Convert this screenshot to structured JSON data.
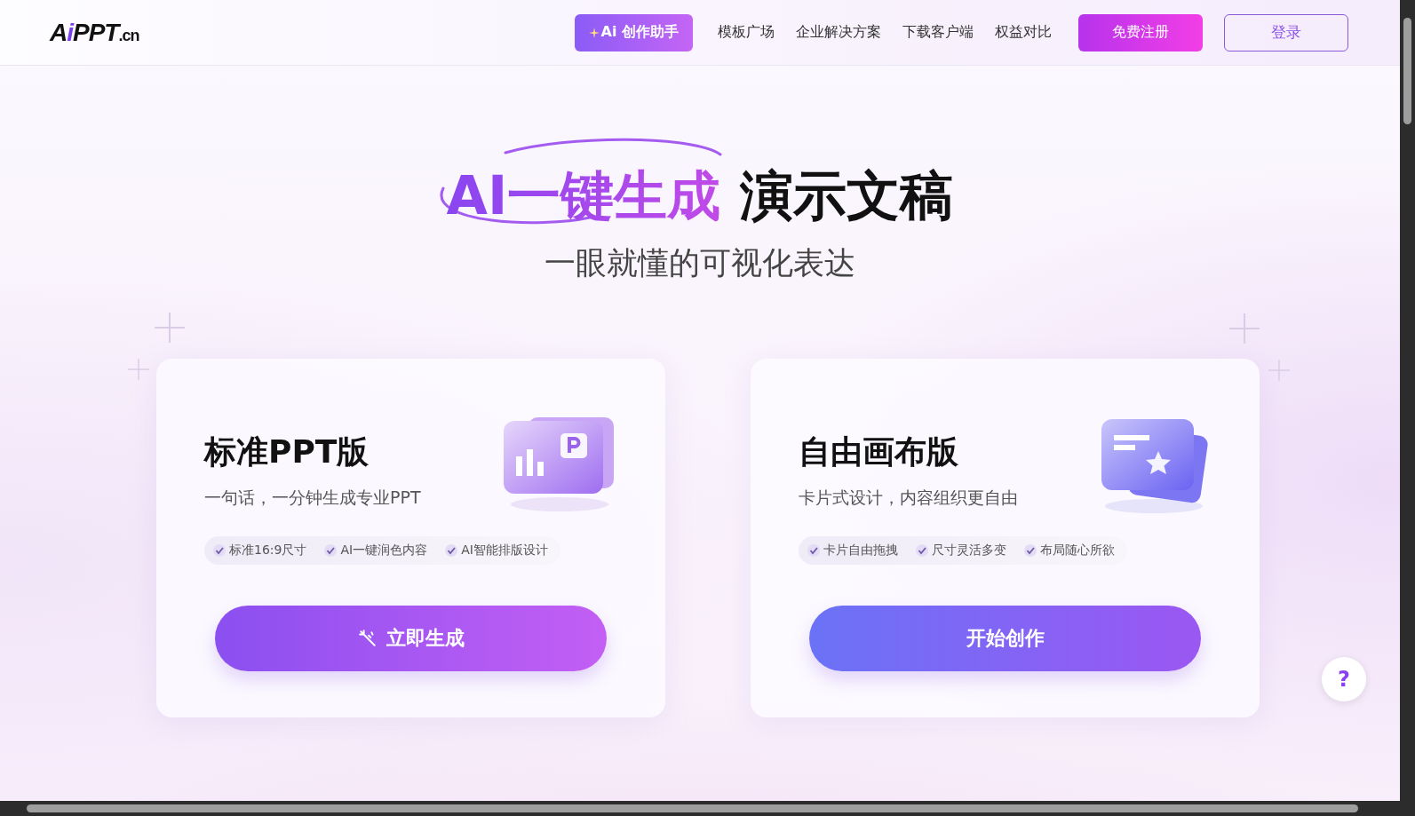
{
  "logo": {
    "initial": "A",
    "accent": "i",
    "name": "PPT",
    "suffix": ".cn"
  },
  "nav": {
    "assistant": "Ai 创作助手",
    "links": [
      "模板广场",
      "企业解决方案",
      "下载客户端",
      "权益对比"
    ],
    "register": "免费注册",
    "login": "登录"
  },
  "hero": {
    "highlight": "AI一键生成",
    "title": "演示文稿",
    "subtitle": "一眼就懂的可视化表达"
  },
  "cards": [
    {
      "kind": "ppt",
      "title": "标准PPT版",
      "subtitle": "一句话，一分钟生成专业PPT",
      "features": [
        "标准16:9尺寸",
        "AI一键润色内容",
        "AI智能排版设计"
      ],
      "button": "立即生成"
    },
    {
      "kind": "canvas",
      "title": "自由画布版",
      "subtitle": "卡片式设计，内容组织更自由",
      "features": [
        "卡片自由拖拽",
        "尺寸灵活多变",
        "布局随心所欲"
      ],
      "button": "开始创作"
    }
  ],
  "help": "?"
}
